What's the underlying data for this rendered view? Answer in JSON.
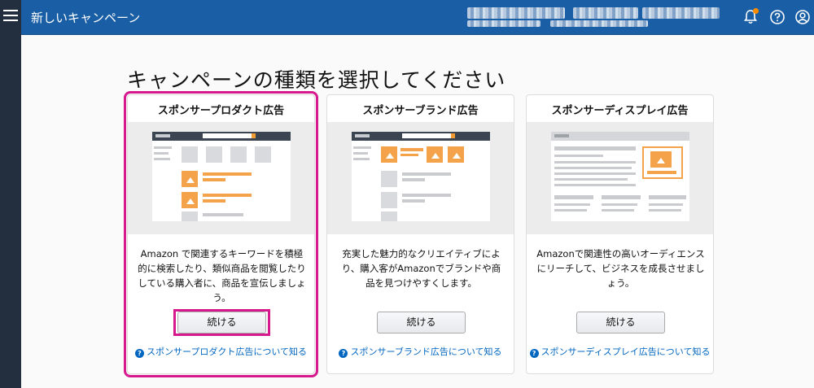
{
  "header": {
    "title": "新しいキャンペーン"
  },
  "page": {
    "title": "キャンペーンの種類を選択してください"
  },
  "cards": [
    {
      "title": "スポンサープロダクト広告",
      "description": "Amazon で関連するキーワードを積極的に検索したり、類似商品を閲覧したりしている購入者に、商品を宣伝しましょう。",
      "button": "続ける",
      "learn_more": "スポンサープロダクト広告について知る",
      "selected": true
    },
    {
      "title": "スポンサーブランド広告",
      "description": "充実した魅力的なクリエイティブにより、購入客がAmazonでブランドや商品を見つけやすくします。",
      "button": "続ける",
      "learn_more": "スポンサーブランド広告について知る",
      "selected": false
    },
    {
      "title": "スポンサーディスプレイ広告",
      "description": "Amazonで関連性の高いオーディエンスにリーチして、ビジネスを成長させましょう。",
      "button": "続ける",
      "learn_more": "スポンサーディスプレイ広告について知る",
      "selected": false
    }
  ],
  "icons": {
    "menu": "hamburger-menu-icon",
    "notifications": "bell-icon",
    "help": "question-circle-icon",
    "account": "user-circle-icon",
    "learn": "question-circle-icon"
  },
  "colors": {
    "header": "#1a5fa5",
    "rail": "#232f3e",
    "accent": "#f5a34a",
    "highlight": "#d6198c",
    "link": "#0066c0",
    "notification_badge": "#ff8c00"
  }
}
